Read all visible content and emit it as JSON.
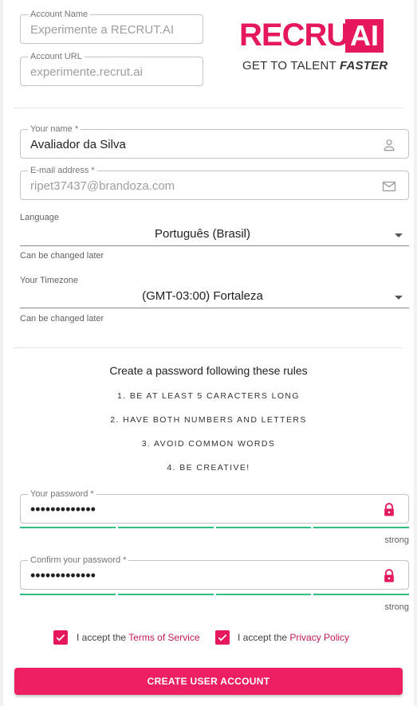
{
  "account": {
    "name_label": "Account Name",
    "name_value": "Experimente a RECRUT.AI",
    "url_label": "Account URL",
    "url_value": "experimente.recrut.ai"
  },
  "logo": {
    "brand_main": "RECRUT.",
    "brand_ai": "AI",
    "tagline_main": "GET TO TALENT ",
    "tagline_emph": "FASTER"
  },
  "user": {
    "name_label": "Your name *",
    "name_value": "Avaliador da Silva",
    "name_icon": "person-icon",
    "email_label": "E-mail address *",
    "email_value": "ripet37437@brandoza.com",
    "email_icon": "mail-icon"
  },
  "language": {
    "label": "Language",
    "value": "Português (Brasil)",
    "hint": "Can be changed later"
  },
  "timezone": {
    "label": "Your Timezone",
    "value": "(GMT-03:00) Fortaleza",
    "hint": "Can be changed later"
  },
  "password_rules": {
    "title": "Create a password following these rules",
    "items": [
      "1. BE AT LEAST 5 CARACTERS LONG",
      "2. HAVE BOTH NUMBERS AND LETTERS",
      "3. AVOID COMMON WORDS",
      "4. BE CREATIVE!"
    ]
  },
  "password": {
    "label": "Your password *",
    "value": "•••••••••••••",
    "strength": "strong",
    "strength_fraction": 1.0
  },
  "confirm_password": {
    "label": "Confirm your password *",
    "value": "•••••••••••••",
    "strength": "strong",
    "strength_fraction": 1.0
  },
  "agreements": {
    "terms_prefix": "I accept the ",
    "terms_link": "Terms of Service",
    "terms_checked": true,
    "privacy_prefix": "I accept the ",
    "privacy_link": "Privacy Policy",
    "privacy_checked": true
  },
  "submit_label": "CREATE USER ACCOUNT",
  "colors": {
    "accent": "#e5175d",
    "strength_bar": "#2ec27e"
  }
}
